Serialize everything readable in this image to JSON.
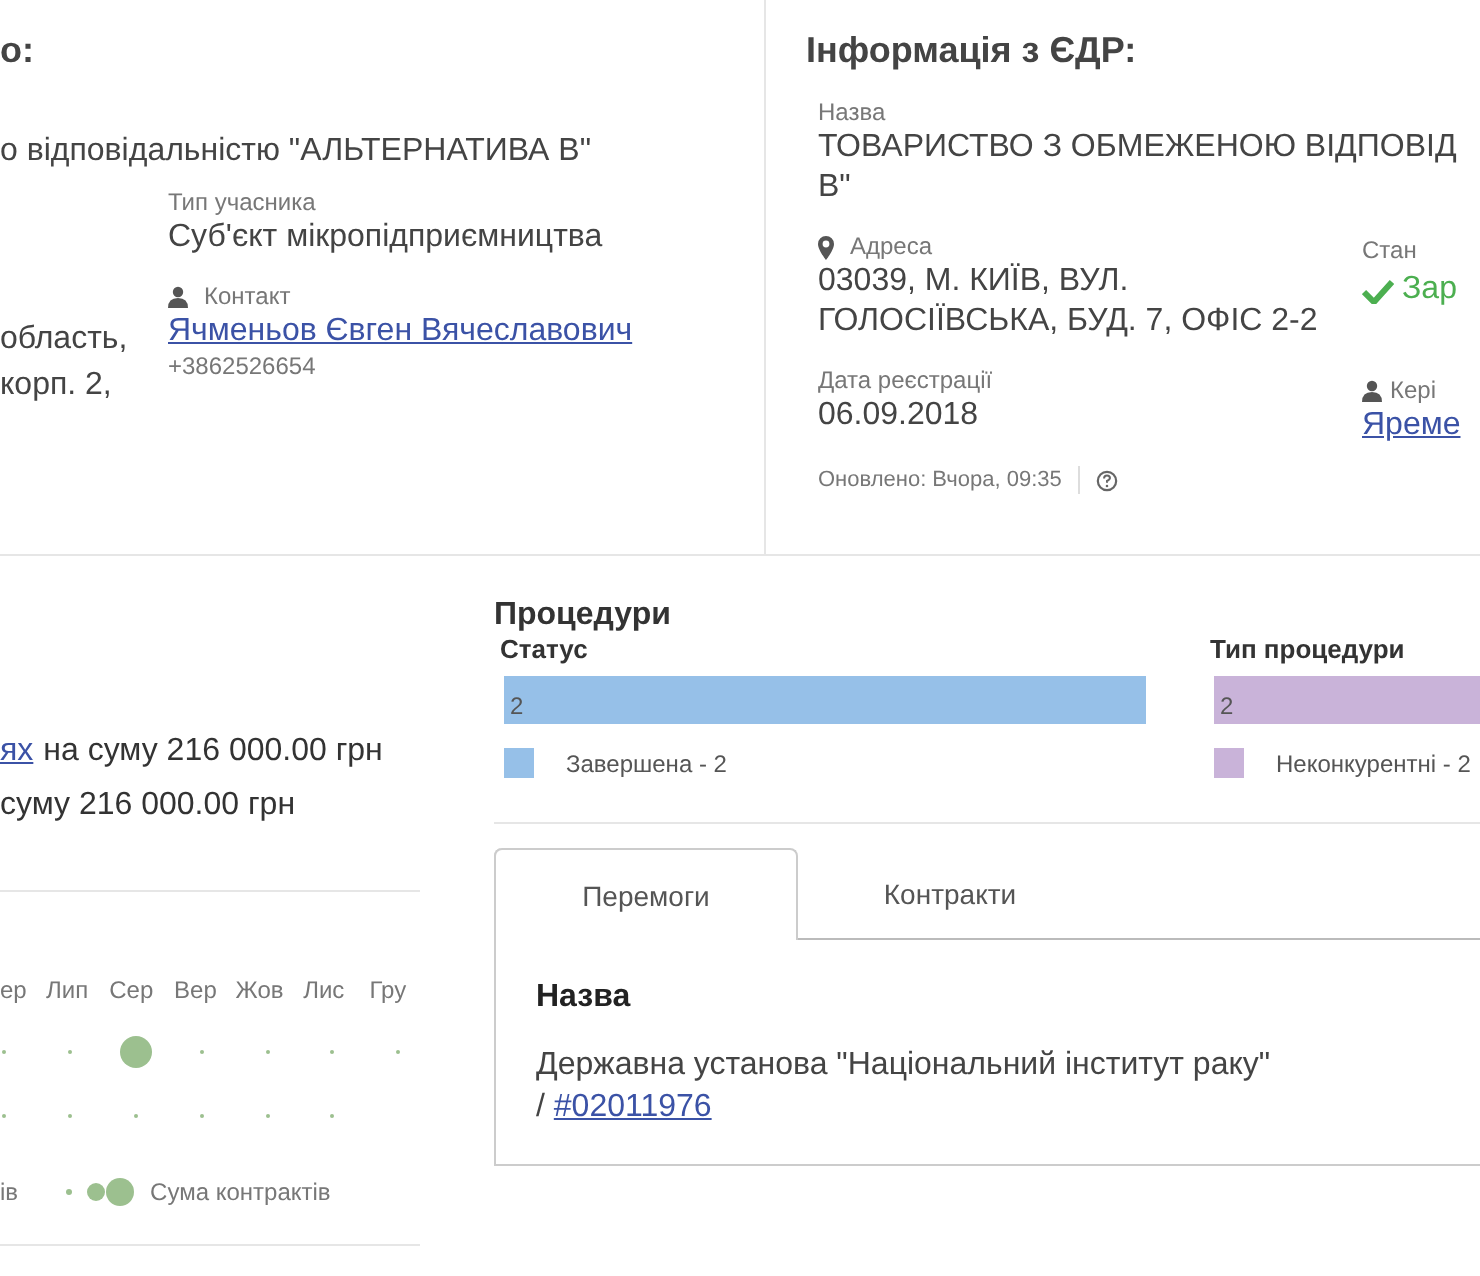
{
  "participant": {
    "heading": "о:",
    "name": "о відповідальністю \"АЛЬТЕРНАТИВА В\"",
    "address_lines": [
      "область,",
      "корп. 2,"
    ],
    "type_label": "Тип учасника",
    "type_value": "Суб'єкт мікропідприємництва",
    "contact_label": "Контакт",
    "contact_name": "Ячменьов Євген Вячеславович",
    "contact_phone": "+3862526654"
  },
  "edr": {
    "heading": "Інформація з ЄДР:",
    "name_label": "Назва",
    "name_lines": [
      "ТОВАРИСТВО З ОБМЕЖЕНОЮ ВІДПОВІД",
      "В\""
    ],
    "address_label": "Адреса",
    "address_lines": [
      "03039, М. КИЇВ, ВУЛ.",
      "ГОЛОСІЇВСЬКА, БУД. 7, ОФІС 2-2"
    ],
    "status_label": "Стан",
    "status_value": "Зар",
    "date_label": "Дата реєстрації",
    "date_value": "06.09.2018",
    "head_label": "Кері",
    "head_value": "Яреме",
    "updated": "Оновлено: Вчора, 09:35"
  },
  "summary": [
    {
      "link": "ях",
      "text": "на суму 216 000.00 грн"
    },
    {
      "text": "суму 216 000.00 грн"
    }
  ],
  "activity": {
    "months": [
      "ер",
      "Лип",
      "Сер",
      "Вер",
      "Жов",
      "Лис",
      "Гру"
    ],
    "legend": [
      "ів",
      "Сума контрактів"
    ]
  },
  "procedures": {
    "title": "Процедури",
    "groups": [
      {
        "title": "Статус",
        "bar_label": "2",
        "color": "#96c0e8",
        "legend": "Завершена - 2"
      },
      {
        "title": "Тип процедури",
        "bar_label": "2",
        "color": "#c9b3d9",
        "legend": "Неконкурентні - 2"
      }
    ]
  },
  "tabs": [
    {
      "label": "Перемоги",
      "selected": true
    },
    {
      "label": "Контракти",
      "selected": false
    }
  ],
  "table": {
    "heading": "Назва",
    "rows": [
      {
        "name": "Державна установа \"Національний інститут раку\"",
        "separator": "/",
        "link": "#02011976"
      }
    ]
  }
}
